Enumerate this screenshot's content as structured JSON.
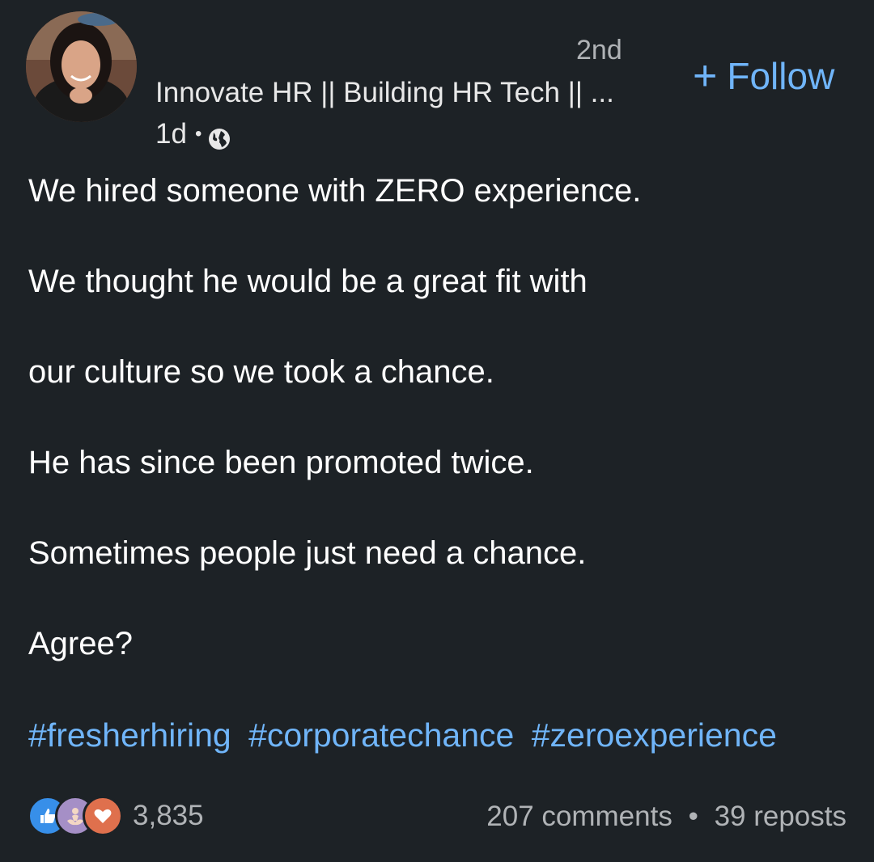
{
  "author": {
    "connection_degree": "2nd",
    "headline": "Innovate HR || Building HR Tech || ...",
    "post_age": "1d",
    "visibility_separator": "•",
    "visibility_icon": "globe-icon"
  },
  "follow": {
    "plus": "+",
    "label": "Follow"
  },
  "post": {
    "lines": [
      "We hired someone with ZERO experience.",
      "We thought he would be a great fit with",
      "our culture so we took a chance.",
      "He has since been promoted twice.",
      "Sometimes people just need a chance.",
      "Agree?"
    ],
    "hashtags": [
      "#fresherhiring",
      "#corporatechance",
      "#zeroexperience"
    ]
  },
  "engagement": {
    "reaction_icons": [
      "like-icon",
      "support-icon",
      "love-icon"
    ],
    "reaction_count": "3,835",
    "comments": "207 comments",
    "separator": "•",
    "reposts": "39 reposts"
  },
  "colors": {
    "background": "#1d2226",
    "link_blue": "#70b5f9",
    "secondary_text": "#b0b3b6",
    "like_blue": "#378fe9",
    "support_purple": "#a58fc6",
    "love_orange": "#df704d"
  }
}
